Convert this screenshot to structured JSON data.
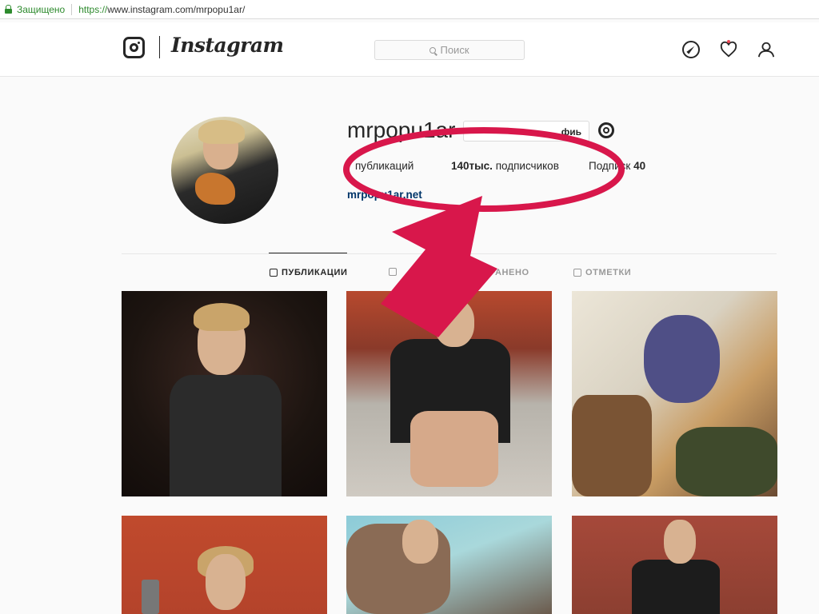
{
  "browser": {
    "secure_label": "Защищено",
    "url_scheme": "https://",
    "url_rest": "www.instagram.com/mrpopu1ar/"
  },
  "header": {
    "wordmark": "Instagram",
    "search_placeholder": "Поиск"
  },
  "profile": {
    "username": "mrpopu1ar",
    "edit_button": "фиь",
    "stats": {
      "posts_label": "публикаций",
      "followers_count": "140тыс.",
      "followers_label": "подписчиков",
      "following_label": "Подписк",
      "following_count": "40"
    },
    "bio_link": "mrpopu1ar.net"
  },
  "tabs": [
    {
      "label": "ПУБЛИКАЦИИ",
      "active": true
    },
    {
      "label": "",
      "active": false
    },
    {
      "label": "РАНЕНО",
      "active": false
    },
    {
      "label": "ОТМЕТКИ",
      "active": false
    }
  ],
  "colors": {
    "annotation": "#d8174b",
    "link": "#003569",
    "secure": "#2e8b2e",
    "notification": "#ed4956"
  },
  "icons": [
    "lock-icon",
    "instagram-camera-icon",
    "search-icon",
    "compass-icon",
    "heart-icon",
    "user-icon",
    "gear-icon",
    "grid-icon",
    "igtv-icon",
    "saved-icon",
    "tagged-icon"
  ]
}
